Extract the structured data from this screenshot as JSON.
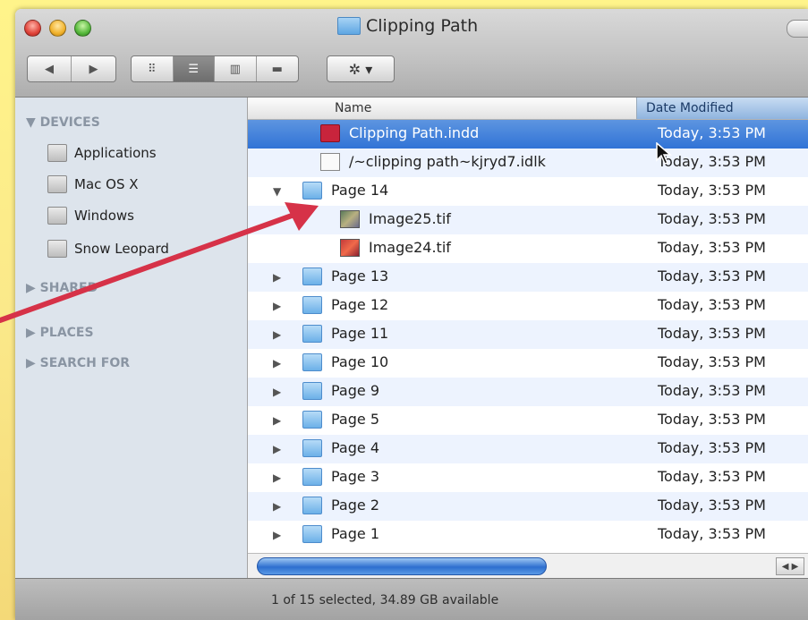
{
  "window": {
    "title": "Clipping Path",
    "title_icon": "folder-icon"
  },
  "toolbar": {
    "back_icon": "◀",
    "forward_icon": "▶",
    "view_icon_icon": "⠿",
    "view_list_icon": "☰",
    "view_column_icon": "▥",
    "view_coverflow_icon": "▬",
    "action_icon": "✲ ▾"
  },
  "sidebar": {
    "devices_label": "▼ DEVICES",
    "items": [
      {
        "label": "Applications"
      },
      {
        "label": "Mac OS X"
      },
      {
        "label": "Windows"
      },
      {
        "label": "Snow Leopard"
      }
    ],
    "shared_label": "▶ SHARED",
    "places_label": "▶ PLACES",
    "search_label": "▶ SEARCH FOR"
  },
  "columns": {
    "name": "Name",
    "date": "Date Modified"
  },
  "files": [
    {
      "name": "Clipping Path.indd",
      "date": "Today, 3:53 PM",
      "kind": "indd",
      "indent": 1,
      "disclosure": "",
      "selected": true
    },
    {
      "name": "/~clipping path~kjryd7.idlk",
      "date": "Today, 3:53 PM",
      "kind": "idlk",
      "indent": 1,
      "disclosure": ""
    },
    {
      "name": "Page 14",
      "date": "Today, 3:53 PM",
      "kind": "folder",
      "indent": 0,
      "disclosure": "▼"
    },
    {
      "name": "Image25.tif",
      "date": "Today, 3:53 PM",
      "kind": "tif1",
      "indent": 2,
      "disclosure": ""
    },
    {
      "name": "Image24.tif",
      "date": "Today, 3:53 PM",
      "kind": "tif2",
      "indent": 2,
      "disclosure": ""
    },
    {
      "name": "Page 13",
      "date": "Today, 3:53 PM",
      "kind": "folder",
      "indent": 0,
      "disclosure": "▶"
    },
    {
      "name": "Page 12",
      "date": "Today, 3:53 PM",
      "kind": "folder",
      "indent": 0,
      "disclosure": "▶"
    },
    {
      "name": "Page 11",
      "date": "Today, 3:53 PM",
      "kind": "folder",
      "indent": 0,
      "disclosure": "▶"
    },
    {
      "name": "Page 10",
      "date": "Today, 3:53 PM",
      "kind": "folder",
      "indent": 0,
      "disclosure": "▶"
    },
    {
      "name": "Page 9",
      "date": "Today, 3:53 PM",
      "kind": "folder",
      "indent": 0,
      "disclosure": "▶"
    },
    {
      "name": "Page 5",
      "date": "Today, 3:53 PM",
      "kind": "folder",
      "indent": 0,
      "disclosure": "▶"
    },
    {
      "name": "Page 4",
      "date": "Today, 3:53 PM",
      "kind": "folder",
      "indent": 0,
      "disclosure": "▶"
    },
    {
      "name": "Page 3",
      "date": "Today, 3:53 PM",
      "kind": "folder",
      "indent": 0,
      "disclosure": "▶"
    },
    {
      "name": "Page 2",
      "date": "Today, 3:53 PM",
      "kind": "folder",
      "indent": 0,
      "disclosure": "▶"
    },
    {
      "name": "Page 1",
      "date": "Today, 3:53 PM",
      "kind": "folder",
      "indent": 0,
      "disclosure": "▶"
    }
  ],
  "scrollbar": {
    "arrows_icon": "◀ ▶"
  },
  "status": {
    "text": "1 of 15 selected, 34.89 GB available"
  },
  "annotation": {
    "arrow_color": "#d63248",
    "points_to": "Page 14"
  }
}
